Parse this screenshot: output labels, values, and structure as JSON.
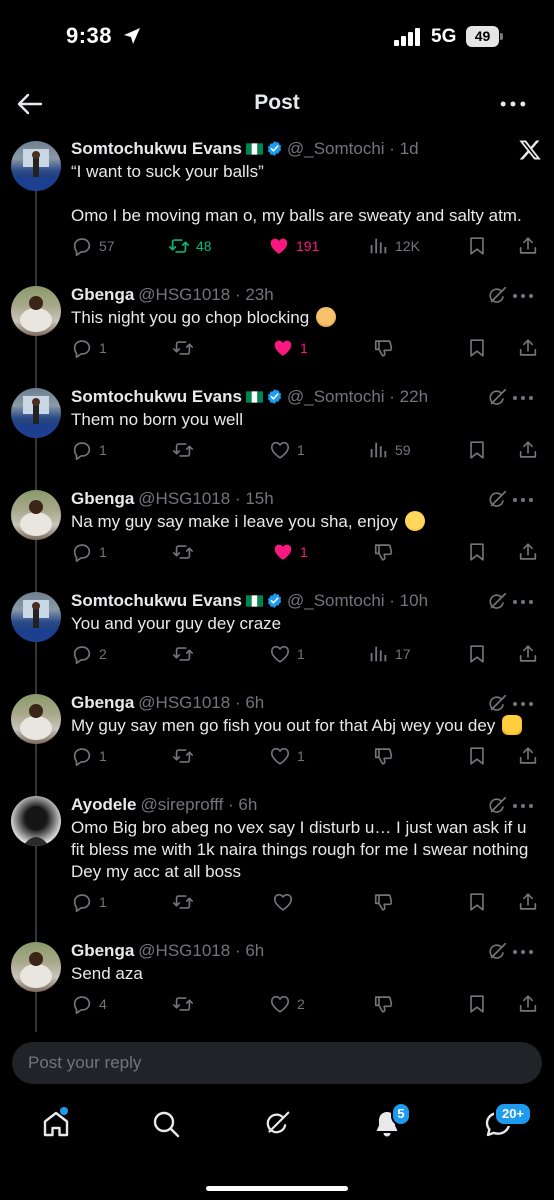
{
  "status_bar": {
    "time": "9:38",
    "network": "5G",
    "battery": "49"
  },
  "header": {
    "title": "Post"
  },
  "posts": [
    {
      "name": "Somtochukwu Evans",
      "flag": "🇳🇬",
      "verified": true,
      "handle": "@_Somtochi",
      "time": "· 1d",
      "text_lines": [
        "“I want to suck your balls”",
        "Omo I be moving man o, my balls are sweaty and salty atm."
      ],
      "replies": "57",
      "reposts": "48",
      "likes": "191",
      "views": "12K"
    },
    {
      "name": "Gbenga",
      "handle": "@HSG1018",
      "time": "· 23h",
      "text": "This night you go chop blocking",
      "emoji": "👨‍🦲",
      "replies": "1",
      "likes": "1"
    },
    {
      "name": "Somtochukwu Evans",
      "flag": "🇳🇬",
      "verified": true,
      "handle": "@_Somtochi",
      "time": "· 22h",
      "text": "Them no born you well",
      "replies": "1",
      "likes": "1",
      "views": "59"
    },
    {
      "name": "Gbenga",
      "handle": "@HSG1018",
      "time": "· 15h",
      "text": "Na my guy say make i leave you sha, enjoy",
      "emoji": "😏",
      "replies": "1",
      "likes": "1"
    },
    {
      "name": "Somtochukwu Evans",
      "flag": "🇳🇬",
      "verified": true,
      "handle": "@_Somtochi",
      "time": "· 10h",
      "text": "You and your guy dey craze",
      "replies": "2",
      "likes": "1",
      "views": "17"
    },
    {
      "name": "Gbenga",
      "handle": "@HSG1018",
      "time": "· 6h",
      "text": "My guy say men go fish you out for that Abj wey you dey",
      "emoji": "👊",
      "replies": "1",
      "likes": "1"
    },
    {
      "name": "Ayodele",
      "handle": "@sireprofff",
      "time": "· 6h",
      "text": "Omo Big bro abeg no vex say I disturb u… I just wan ask if u fit bless me with 1k naira things rough for me I swear nothing Dey my acc at all boss",
      "replies": "1"
    },
    {
      "name": "Gbenga",
      "handle": "@HSG1018",
      "time": "· 6h",
      "text": "Send aza",
      "replies": "4",
      "likes": "2"
    }
  ],
  "reply_bar": {
    "placeholder": "Post your reply"
  },
  "nav": {
    "notifications_badge": "5",
    "messages_badge": "20+"
  },
  "colors": {
    "background": "#000000",
    "text": "#e7e9ea",
    "muted": "#71767b",
    "like": "#f91880",
    "repost": "#00ba7c",
    "accent": "#1d9bf0"
  }
}
